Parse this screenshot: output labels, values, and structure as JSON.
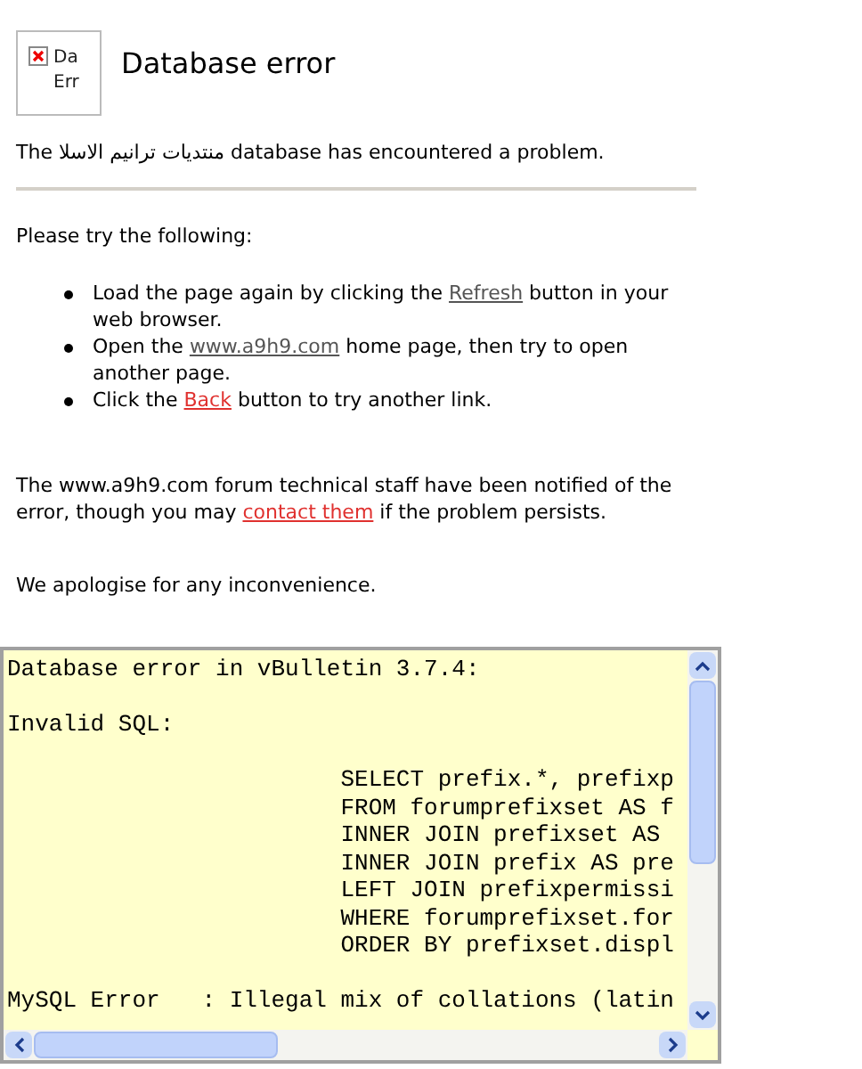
{
  "header": {
    "image_alt_lines": [
      "Da",
      "Err"
    ],
    "title": "Database error"
  },
  "intro": "The منتديات ترانيم الاسلا database has encountered a problem.",
  "suggestions_heading": "Please try the following:",
  "suggestions": [
    [
      {
        "kind": "text",
        "text": "Load the page again by clicking the "
      },
      {
        "kind": "link",
        "text": "Refresh",
        "visited": false
      },
      {
        "kind": "text",
        "text": " button in your web browser."
      }
    ],
    [
      {
        "kind": "text",
        "text": "Open the "
      },
      {
        "kind": "link",
        "text": "www.a9h9.com",
        "visited": false
      },
      {
        "kind": "text",
        "text": " home page, then try to open another page."
      }
    ],
    [
      {
        "kind": "text",
        "text": "Click the "
      },
      {
        "kind": "link",
        "text": "Back",
        "visited": true
      },
      {
        "kind": "text",
        "text": " button to try another link."
      }
    ]
  ],
  "notice": [
    {
      "kind": "text",
      "text": "The www.a9h9.com forum technical staff have been notified of the error, though you may "
    },
    {
      "kind": "link",
      "text": "contact them",
      "visited": true
    },
    {
      "kind": "text",
      "text": " if the problem persists."
    }
  ],
  "apology": "We apologise for any inconvenience.",
  "error_details": {
    "blocks": [
      [
        "Database error in vBulletin 3.7.4:"
      ],
      [
        "Invalid SQL:"
      ],
      [
        "                        SELECT prefix.*, prefixp",
        "                        FROM forumprefixset AS f",
        "                        INNER JOIN prefixset AS ",
        "                        INNER JOIN prefix AS pre",
        "                        LEFT JOIN prefixpermissi",
        "                        WHERE forumprefixset.for",
        "                        ORDER BY prefixset.displ"
      ],
      [
        "MySQL Error   : Illegal mix of collations (latin"
      ]
    ]
  }
}
